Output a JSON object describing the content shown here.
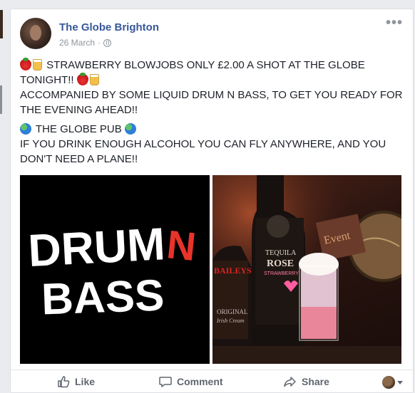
{
  "post": {
    "page_name": "The Globe Brighton",
    "date": "26 March",
    "separator": "·",
    "more": "•••",
    "paragraphs": [
      {
        "line1": "STRAWBERRY BLOWJOBS ONLY £2.00 A SHOT AT THE GLOBE",
        "line2": "TONIGHT!!",
        "line3": "ACCOMPANIED BY SOME LIQUID DRUM N BASS, TO GET YOU READY FOR THE EVENING AHEAD!!"
      },
      {
        "line1": "THE GLOBE PUB",
        "line2": "IF YOU DRINK ENOUGH ALCOHOL YOU CAN FLY ANYWHERE, AND YOU DON'T NEED A PLANE!!"
      }
    ],
    "images": [
      {
        "name": "drum-n-bass-image",
        "word1a": "DRUM",
        "word1b": "N",
        "word2": "BASS"
      },
      {
        "name": "drinks-photo",
        "bottle1_label": "BAILEYS",
        "bottle1_sub": "ORIGINAL",
        "bottle1_sub2": "Irish Cream",
        "bottle2_label": "TEQUILA",
        "bottle2_sub": "ROSE",
        "bottle2_sub2": "STRAWBERRY",
        "sign": "Event"
      }
    ]
  },
  "actions": {
    "like": "Like",
    "comment": "Comment",
    "share": "Share"
  },
  "colors": {
    "link": "#365899",
    "accent_red": "#e8332a"
  }
}
